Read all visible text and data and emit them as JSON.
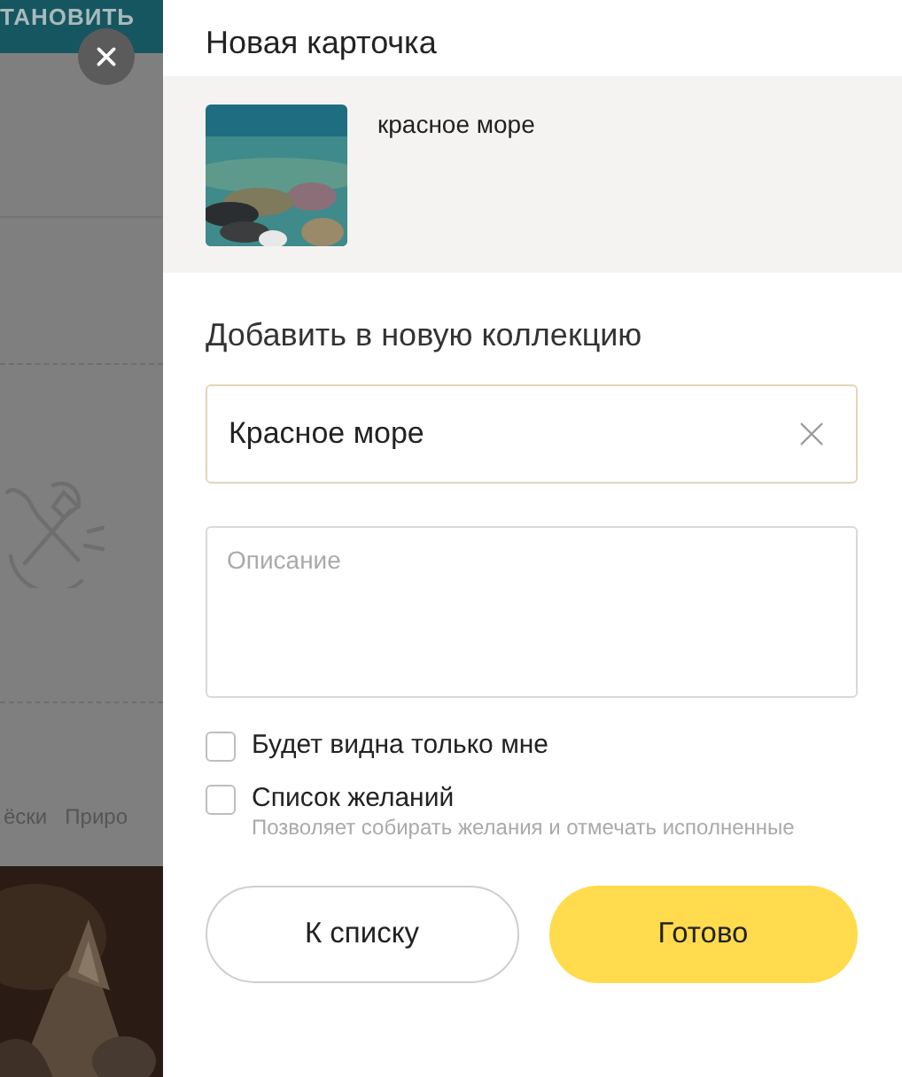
{
  "background_page": {
    "header_button": "ТАНОВИТЬ",
    "tabs": [
      "ёски",
      "Приро"
    ]
  },
  "panel": {
    "title": "Новая карточка",
    "card": {
      "caption": "красное море"
    },
    "section_title": "Добавить в новую коллекцию",
    "name_field": {
      "value": "Красное море"
    },
    "description_field": {
      "placeholder": "Описание"
    },
    "options": [
      {
        "label": "Будет видна только мне",
        "checked": false
      },
      {
        "label": "Список желаний",
        "hint": "Позволяет собирать желания и отмечать исполненные",
        "checked": false
      }
    ],
    "buttons": [
      {
        "label": "К списку",
        "kind": "secondary"
      },
      {
        "label": "Готово",
        "kind": "primary"
      }
    ]
  }
}
